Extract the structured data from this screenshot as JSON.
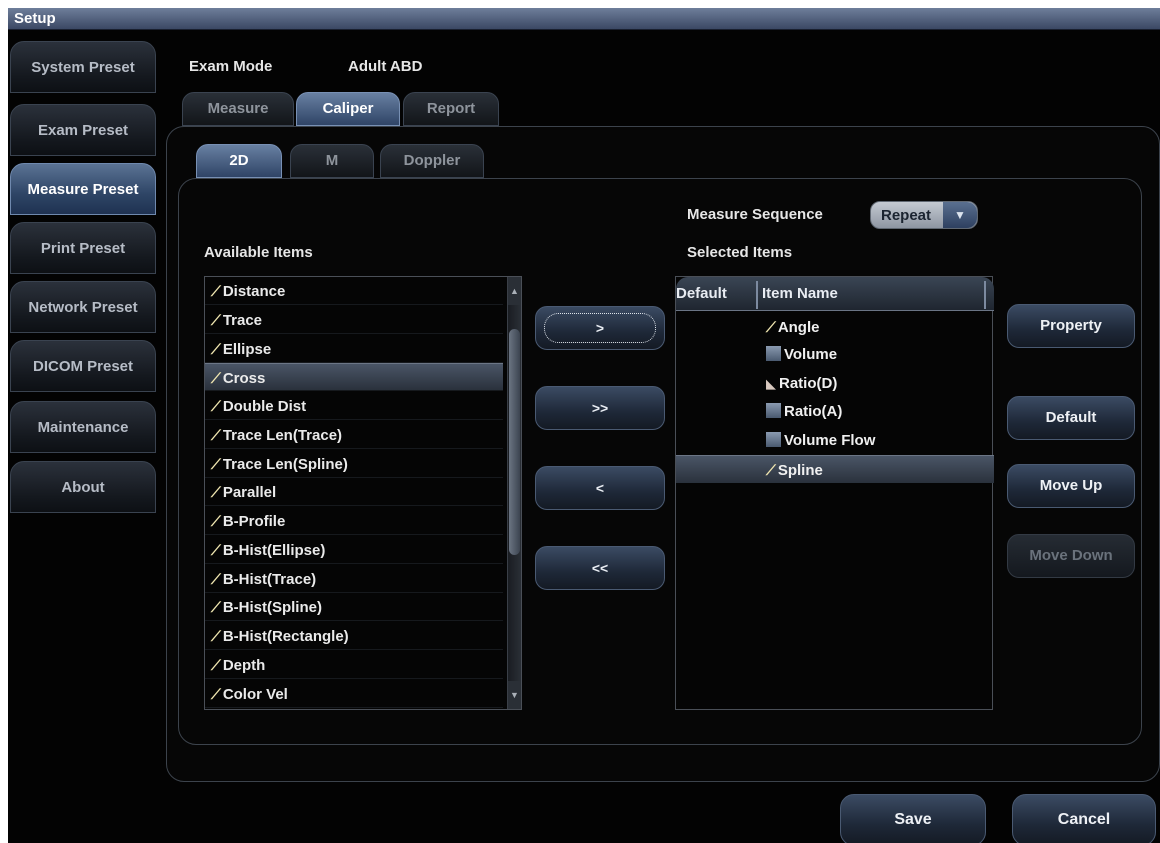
{
  "window": {
    "title": "Setup"
  },
  "sidebar": {
    "items": [
      {
        "label": "System Preset",
        "active": false
      },
      {
        "label": "Exam Preset",
        "active": false
      },
      {
        "label": "Measure Preset",
        "active": true
      },
      {
        "label": "Print Preset",
        "active": false
      },
      {
        "label": "Network Preset",
        "active": false
      },
      {
        "label": "DICOM Preset",
        "active": false
      },
      {
        "label": "Maintenance",
        "active": false
      },
      {
        "label": "About",
        "active": false
      }
    ]
  },
  "exam": {
    "mode_label": "Exam Mode",
    "mode_value": "Adult ABD"
  },
  "top_tabs": [
    {
      "label": "Measure",
      "active": false
    },
    {
      "label": "Caliper",
      "active": true
    },
    {
      "label": "Report",
      "active": false
    }
  ],
  "sub_tabs": [
    {
      "label": "2D",
      "active": true
    },
    {
      "label": "M",
      "active": false
    },
    {
      "label": "Doppler",
      "active": false
    }
  ],
  "sequence": {
    "label": "Measure Sequence",
    "value": "Repeat"
  },
  "available": {
    "title": "Available Items",
    "items": [
      "Distance",
      "Trace",
      "Ellipse",
      "Cross",
      "Double Dist",
      "Trace Len(Trace)",
      "Trace Len(Spline)",
      "Parallel",
      "B-Profile",
      "B-Hist(Ellipse)",
      "B-Hist(Trace)",
      "B-Hist(Spline)",
      "B-Hist(Rectangle)",
      "Depth",
      "Color Vel"
    ],
    "selected_index": 3
  },
  "transfer_buttons": [
    ">",
    ">>",
    "<",
    "<<"
  ],
  "selected": {
    "title": "Selected Items",
    "col_default": "Default",
    "col_name": "Item Name",
    "rows": [
      {
        "name": "Angle",
        "icon": "caliper-icon"
      },
      {
        "name": "Volume",
        "icon": "square-icon"
      },
      {
        "name": "Ratio(D)",
        "icon": "ratio-icon"
      },
      {
        "name": "Ratio(A)",
        "icon": "square-icon"
      },
      {
        "name": "Volume Flow",
        "icon": "square-icon"
      },
      {
        "name": "Spline",
        "icon": "caliper-icon"
      }
    ],
    "selected_index": 5
  },
  "actions": {
    "property": "Property",
    "default": "Default",
    "move_up": "Move Up",
    "move_down": "Move Down"
  },
  "footer": {
    "save": "Save",
    "cancel": "Cancel"
  },
  "colors": {
    "accent": "#2f4466",
    "background": "#030303",
    "text": "#e6e6e6"
  }
}
